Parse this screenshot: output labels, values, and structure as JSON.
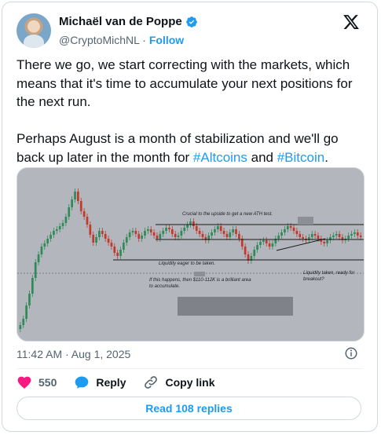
{
  "author": {
    "name": "Michaël van de Poppe",
    "handle": "@CryptoMichNL",
    "separator": "·",
    "follow_label": "Follow"
  },
  "tweet": {
    "text_part1": "There we go, we start correcting with the markets, which means that it's time to accumulate your next positions for the next run.\n\nPerhaps August is a month of stabilization and we'll go back up later in the month for ",
    "hashtag1": "#Altcoins",
    "connector": " and ",
    "hashtag2": "#Bitcoin",
    "ending": "."
  },
  "chart_image": {
    "annotations": {
      "top": "Crucial to the upside to get a new ATH test.",
      "liquidity": "Liquidity eager to be taken.",
      "if_line1": "If this happens, then $110-112K is a brilliant area",
      "if_line2": "to accumulate.",
      "right_line1": "Liquidity taken, ready for",
      "right_line2": "breakout?"
    }
  },
  "meta": {
    "timestamp": "11:42 AM · Aug 1, 2025"
  },
  "actions": {
    "likes": "550",
    "reply": "Reply",
    "copy_link": "Copy link"
  },
  "read_replies": "Read 108 replies",
  "colors": {
    "accent": "#1d9bf0",
    "like": "#f91880",
    "candle_up": "#2e8b57",
    "candle_down": "#c0392b"
  }
}
